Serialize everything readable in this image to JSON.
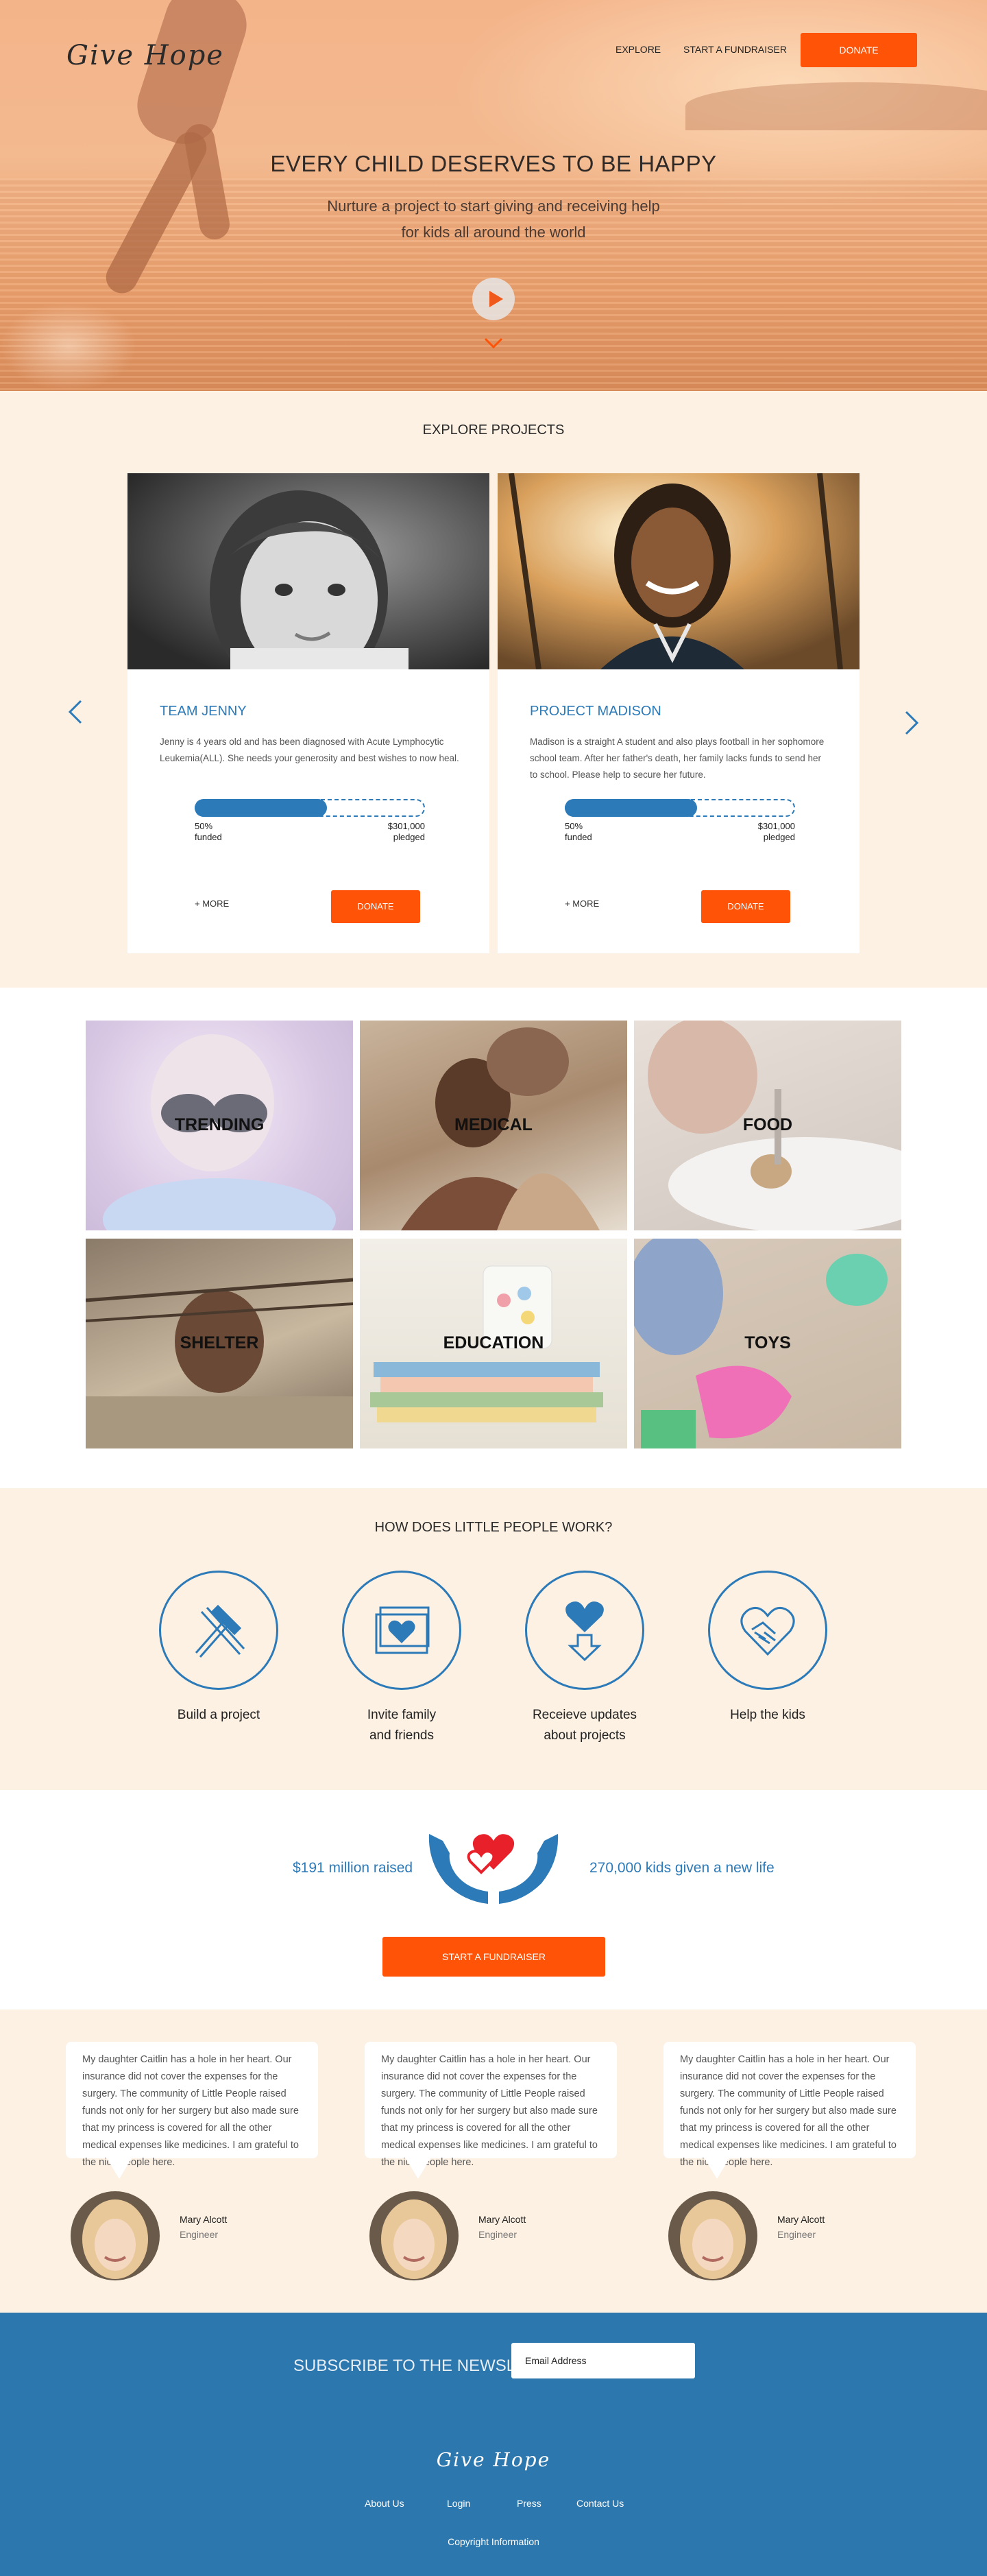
{
  "brand": {
    "name": "Give Hope",
    "accent": "#ff5307",
    "primary": "#2c7ab8",
    "cream": "#fdf1e3"
  },
  "nav": {
    "explore": "EXPLORE",
    "start": "START A FUNDRAISER",
    "donate": "DONATE"
  },
  "hero": {
    "title": "EVERY CHILD DESERVES TO BE HAPPY",
    "subtitle": "Nurture a project to start giving and receiving help for kids all around the world",
    "play_icon": "play-icon",
    "scroll_icon": "chevron-down-icon"
  },
  "explore": {
    "title": "EXPLORE PROJECTS",
    "prev_icon": "chevron-left-icon",
    "next_icon": "chevron-right-icon",
    "projects": [
      {
        "title": "TEAM JENNY",
        "description": "Jenny is 4 years old and  has been diagnosed with Acute Lymphocytic Leukemia(ALL). She needs your generosity and best wishes to now heal.",
        "percent": "50%",
        "funded_label": "funded",
        "funded_fraction": 0.58,
        "amount": "$301,000",
        "pledged_label": "pledged",
        "more": "+ MORE",
        "donate": "DONATE"
      },
      {
        "title": "PROJECT MADISON",
        "description": "Madison is a straight A student and also plays football in her sophomore school team. After her father's death, her family lacks funds to send her to school. Please help to secure her future.",
        "percent": "50%",
        "funded_label": "funded",
        "funded_fraction": 0.58,
        "amount": "$301,000",
        "pledged_label": "pledged",
        "more": "+ MORE",
        "donate": "DONATE"
      }
    ]
  },
  "categories": [
    {
      "label": "TRENDING"
    },
    {
      "label": "MEDICAL"
    },
    {
      "label": "FOOD"
    },
    {
      "label": "SHELTER"
    },
    {
      "label": "EDUCATION"
    },
    {
      "label": "TOYS"
    }
  ],
  "how": {
    "title": "HOW DOES LITTLE PEOPLE WORK?",
    "steps": [
      {
        "line1": "Build a project",
        "line2": "",
        "icon": "hammer-icon"
      },
      {
        "line1": "Invite family",
        "line2": "and friends",
        "icon": "heart-card-icon"
      },
      {
        "line1": "Receieve updates",
        "line2": "about projects",
        "icon": "heart-arrow-icon"
      },
      {
        "line1": "Help the kids",
        "line2": "",
        "icon": "handshake-heart-icon"
      }
    ]
  },
  "stats": {
    "raised": "$191 million raised",
    "kids": "270,000 kids given a new life",
    "icon": "hands-hearts-icon",
    "cta": "START A FUNDRAISER"
  },
  "testimonials": [
    {
      "quote": "My daughter Caitlin has a hole in her heart. Our insurance did not cover the expenses for the surgery. The community of Little People raised funds not only for her surgery but also made sure that my princess is covered for all the other medical expenses like medicines. I am grateful to the nice people here.",
      "name": "Mary Alcott",
      "role": "Engineer"
    },
    {
      "quote": "My daughter Caitlin has a hole in her heart. Our insurance did not cover the expenses for the surgery. The community of Little People raised funds not only for her surgery but also made sure that my princess is covered for all the other medical expenses like medicines. I am grateful to the nice people here.",
      "name": "Mary Alcott",
      "role": "Engineer"
    },
    {
      "quote": "My daughter Caitlin has a hole in her heart. Our insurance did not cover the expenses for the surgery. The community of Little People raised funds not only for her surgery but also made sure that my princess is covered for all the other medical expenses like medicines. I am grateful to the nice people here.",
      "name": "Mary Alcott",
      "role": "Engineer"
    }
  ],
  "footer": {
    "newsletter": "SUBSCRIBE TO THE NEWSLETTER",
    "email_placeholder": "Email Address",
    "links": [
      "About Us",
      "Login",
      "Press",
      "Contact Us"
    ],
    "copyright": "Copyright Information"
  }
}
